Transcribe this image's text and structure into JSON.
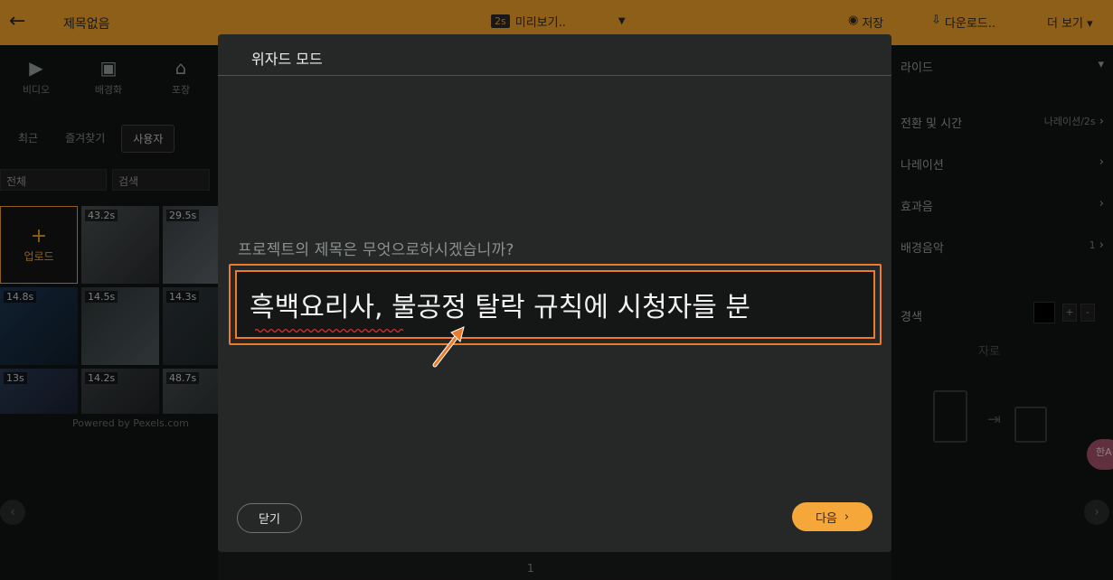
{
  "topbar": {
    "back_icon": "←",
    "title": "제목없음",
    "preview_badge": "2s",
    "preview_label": "미리보기..",
    "save_label": "저장",
    "download_label": "다운로드..",
    "more_label": "더 보기"
  },
  "left_panel": {
    "categories": [
      {
        "label": "비디오",
        "icon": "video-icon"
      },
      {
        "label": "배경화",
        "icon": "image-icon"
      },
      {
        "label": "포장",
        "icon": "home-icon"
      }
    ],
    "tabs": [
      "최근",
      "즐겨찾기",
      "사용자"
    ],
    "filter_all": "전체",
    "search_placeholder": "검색",
    "upload_label": "업로드",
    "upload_plus": "+",
    "durations": [
      "43.2s",
      "29.5s",
      "14.8s",
      "14.5s",
      "14.3s",
      "13s",
      "14.2s",
      "48.7s"
    ],
    "powered_by": "Powered by Pexels.com"
  },
  "right_panel": {
    "header": "라이드",
    "rows": [
      {
        "label": "전환 및 시간",
        "sub": "나레이션/2s"
      },
      {
        "label": "나레이션",
        "sub": ""
      },
      {
        "label": "효과음",
        "sub": ""
      },
      {
        "label": "배경음악",
        "sub": "1"
      }
    ],
    "color_label": "경색",
    "section_label": "자로",
    "plus": "+",
    "minus": "-"
  },
  "translate_fab": "한A",
  "page_number": "1",
  "modal": {
    "title": "위자드 모드",
    "question": "프로젝트의 제목은 무엇으로하시겠습니까?",
    "title_value": "흑백요리사, 불공정 탈락 규칙에 시청자들 분",
    "close_label": "닫기",
    "next_label": "다음",
    "next_icon": "›"
  },
  "colors": {
    "accent": "#f3a42c",
    "highlight": "#ee7a2c",
    "modal_bg": "#262828"
  }
}
